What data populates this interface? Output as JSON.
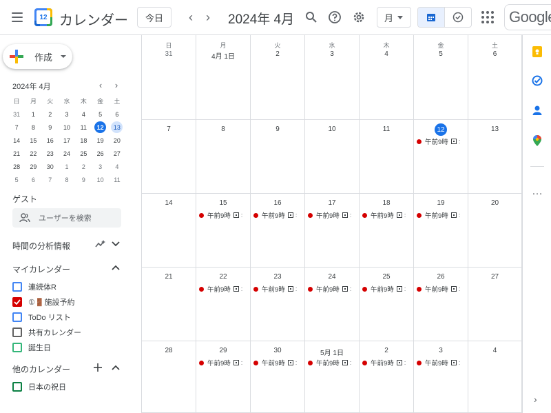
{
  "header": {
    "app_title": "カレンダー",
    "logo_day": "12",
    "today_label": "今日",
    "prev_icon": "chevron-left-icon",
    "next_icon": "chevron-right-icon",
    "current_period": "2024年 4月",
    "view_label": "月",
    "brand_label": "Google"
  },
  "sidebar": {
    "create_label": "作成",
    "mini_calendar": {
      "title": "2024年 4月",
      "weekdays": [
        "日",
        "月",
        "火",
        "水",
        "木",
        "金",
        "土"
      ],
      "weeks": [
        [
          "31",
          "1",
          "2",
          "3",
          "4",
          "5",
          "6"
        ],
        [
          "7",
          "8",
          "9",
          "10",
          "11",
          "12",
          "13"
        ],
        [
          "14",
          "15",
          "16",
          "17",
          "18",
          "19",
          "20"
        ],
        [
          "21",
          "22",
          "23",
          "24",
          "25",
          "26",
          "27"
        ],
        [
          "28",
          "29",
          "30",
          "1",
          "2",
          "3",
          "4"
        ],
        [
          "5",
          "6",
          "7",
          "8",
          "9",
          "10",
          "11"
        ]
      ],
      "today": "12",
      "selected": "13"
    },
    "guest_title": "ゲスト",
    "guest_search_placeholder": "ユーザーを検索",
    "insights_title": "時間の分析情報",
    "my_calendars_title": "マイカレンダー",
    "my_calendars": [
      {
        "label": "連続体R",
        "color": "#4285f4",
        "checked": false
      },
      {
        "label": "①🚪施設予約",
        "color": "#d50000",
        "checked": true
      },
      {
        "label": "ToDo リスト",
        "color": "#4285f4",
        "checked": false
      },
      {
        "label": "共有カレンダー",
        "color": "#616161",
        "checked": false
      },
      {
        "label": "誕生日",
        "color": "#33b679",
        "checked": false
      }
    ],
    "other_calendars_title": "他のカレンダー",
    "other_calendars": [
      {
        "label": "日本の祝日",
        "color": "#0b8043",
        "checked": false
      }
    ]
  },
  "month_grid": {
    "weekdays": [
      "日",
      "月",
      "火",
      "水",
      "木",
      "金",
      "土"
    ],
    "weeks": [
      [
        {
          "label": "31",
          "other": true,
          "events": []
        },
        {
          "label": "4月 1日",
          "other": false,
          "events": []
        },
        {
          "label": "2",
          "other": false,
          "events": []
        },
        {
          "label": "3",
          "other": false,
          "events": []
        },
        {
          "label": "4",
          "other": false,
          "events": []
        },
        {
          "label": "5",
          "other": false,
          "events": []
        },
        {
          "label": "6",
          "other": false,
          "events": []
        }
      ],
      [
        {
          "label": "7",
          "other": false,
          "events": []
        },
        {
          "label": "8",
          "other": false,
          "events": []
        },
        {
          "label": "9",
          "other": false,
          "events": []
        },
        {
          "label": "10",
          "other": false,
          "events": []
        },
        {
          "label": "11",
          "other": false,
          "events": []
        },
        {
          "label": "12",
          "other": false,
          "today": true,
          "events": [
            "午前9時"
          ]
        },
        {
          "label": "13",
          "other": false,
          "events": []
        }
      ],
      [
        {
          "label": "14",
          "other": false,
          "events": []
        },
        {
          "label": "15",
          "other": false,
          "events": [
            "午前9時"
          ]
        },
        {
          "label": "16",
          "other": false,
          "events": [
            "午前9時"
          ]
        },
        {
          "label": "17",
          "other": false,
          "events": [
            "午前9時"
          ]
        },
        {
          "label": "18",
          "other": false,
          "events": [
            "午前9時"
          ]
        },
        {
          "label": "19",
          "other": false,
          "events": [
            "午前9時"
          ]
        },
        {
          "label": "20",
          "other": false,
          "events": []
        }
      ],
      [
        {
          "label": "21",
          "other": false,
          "events": []
        },
        {
          "label": "22",
          "other": false,
          "events": [
            "午前9時"
          ]
        },
        {
          "label": "23",
          "other": false,
          "events": [
            "午前9時"
          ]
        },
        {
          "label": "24",
          "other": false,
          "events": [
            "午前9時"
          ]
        },
        {
          "label": "25",
          "other": false,
          "events": [
            "午前9時"
          ]
        },
        {
          "label": "26",
          "other": false,
          "events": [
            "午前9時"
          ]
        },
        {
          "label": "27",
          "other": false,
          "events": []
        }
      ],
      [
        {
          "label": "28",
          "other": false,
          "events": []
        },
        {
          "label": "29",
          "other": false,
          "events": [
            "午前9時"
          ]
        },
        {
          "label": "30",
          "other": false,
          "events": [
            "午前9時"
          ]
        },
        {
          "label": "5月 1日",
          "other": false,
          "events": [
            "午前9時"
          ]
        },
        {
          "label": "2",
          "other": false,
          "events": [
            "午前9時"
          ]
        },
        {
          "label": "3",
          "other": false,
          "events": [
            "午前9時"
          ]
        },
        {
          "label": "4",
          "other": false,
          "events": []
        }
      ]
    ]
  },
  "right_rail": {
    "icons": [
      "keep-icon",
      "tasks-icon",
      "contacts-icon",
      "maps-icon"
    ],
    "more_label": "…"
  },
  "colors": {
    "accent": "#1a73e8",
    "event_dot": "#d50000",
    "border": "#dadce0"
  }
}
